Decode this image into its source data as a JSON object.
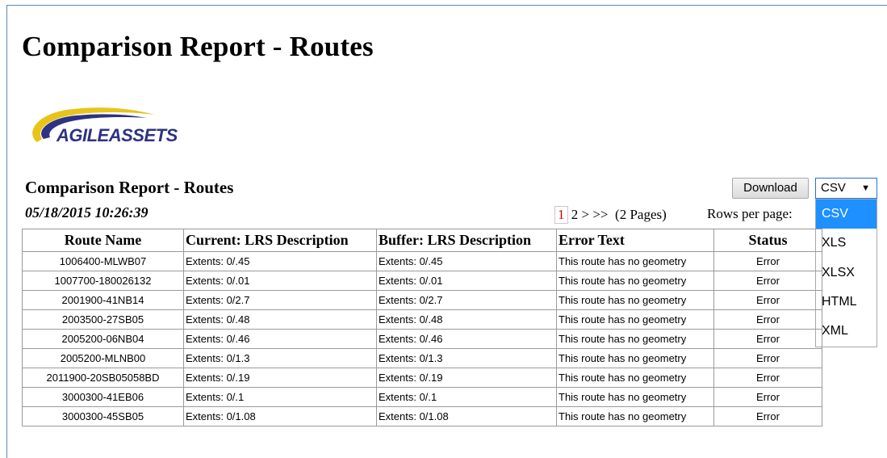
{
  "page": {
    "title": "Comparison Report - Routes"
  },
  "logo": {
    "text": "AGILEASSETS"
  },
  "report": {
    "title": "Comparison Report - Routes",
    "date": "05/18/2015 10:26:39"
  },
  "toolbar": {
    "download_label": "Download",
    "format_selected": "CSV",
    "format_options": [
      "CSV",
      "XLS",
      "XLSX",
      "HTML",
      "XML"
    ]
  },
  "pagination": {
    "current": "1",
    "next_page": "2",
    "next": ">",
    "last": ">>",
    "summary": "(2 Pages)",
    "rows_per_page_label": "Rows per page:"
  },
  "table": {
    "headers": [
      "Route Name",
      "Current: LRS Description",
      "Buffer: LRS Description",
      "Error Text",
      "Status"
    ],
    "rows": [
      [
        "1006400-MLWB07",
        "Extents: 0/.45",
        "Extents: 0/.45",
        "This route has no geometry",
        "Error"
      ],
      [
        "1007700-180026132",
        "Extents: 0/.01",
        "Extents: 0/.01",
        "This route has no geometry",
        "Error"
      ],
      [
        "2001900-41NB14",
        "Extents: 0/2.7",
        "Extents: 0/2.7",
        "This route has no geometry",
        "Error"
      ],
      [
        "2003500-27SB05",
        "Extents: 0/.48",
        "Extents: 0/.48",
        "This route has no geometry",
        "Error"
      ],
      [
        "2005200-06NB04",
        "Extents: 0/.46",
        "Extents: 0/.46",
        "This route has no geometry",
        "Error"
      ],
      [
        "2005200-MLNB00",
        "Extents: 0/1.3",
        "Extents: 0/1.3",
        "This route has no geometry",
        "Error"
      ],
      [
        "2011900-20SB05058BD",
        "Extents: 0/.19",
        "Extents: 0/.19",
        "This route has no geometry",
        "Error"
      ],
      [
        "3000300-41EB06",
        "Extents: 0/.1",
        "Extents: 0/.1",
        "This route has no geometry",
        "Error"
      ],
      [
        "3000300-45SB05",
        "Extents: 0/1.08",
        "Extents: 0/1.08",
        "This route has no geometry",
        "Error"
      ]
    ]
  }
}
